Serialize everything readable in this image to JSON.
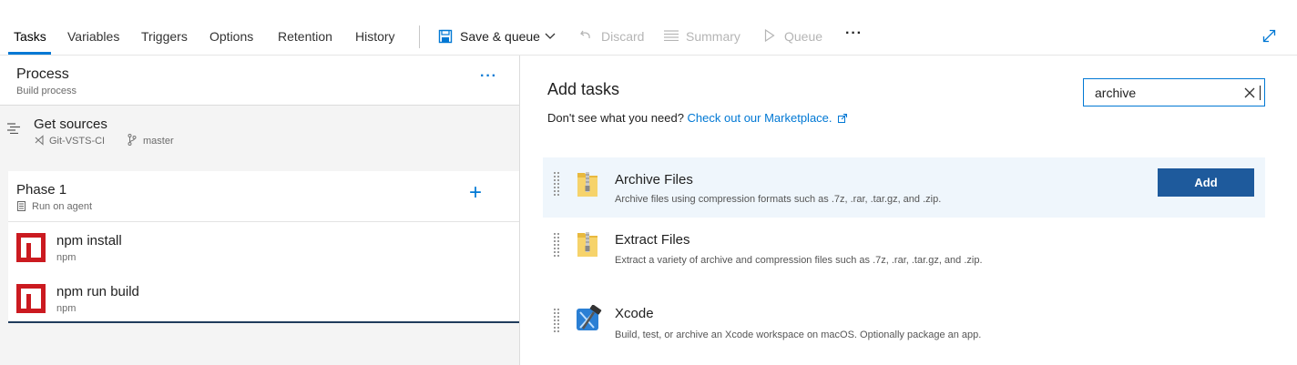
{
  "tabs": [
    {
      "label": "Tasks",
      "active": true
    },
    {
      "label": "Variables"
    },
    {
      "label": "Triggers"
    },
    {
      "label": "Options"
    },
    {
      "label": "Retention"
    },
    {
      "label": "History"
    }
  ],
  "toolbar": {
    "save_queue": "Save & queue",
    "discard": "Discard",
    "summary": "Summary",
    "queue": "Queue",
    "more": "···"
  },
  "process": {
    "title": "Process",
    "subtitle": "Build process",
    "more": "···"
  },
  "get_sources": {
    "title": "Get sources",
    "repo": "Git-VSTS-CI",
    "branch": "master"
  },
  "phase": {
    "title": "Phase 1",
    "subtitle": "Run on agent",
    "add": "+"
  },
  "phase_tasks": [
    {
      "title": "npm install",
      "subtitle": "npm"
    },
    {
      "title": "npm run build",
      "subtitle": "npm"
    }
  ],
  "add_tasks": {
    "title": "Add tasks",
    "dont_see": "Don't see what you need?",
    "marketplace": "Check out our Marketplace.",
    "search_value": "archive",
    "add_button": "Add"
  },
  "results": [
    {
      "title": "Archive Files",
      "desc": "Archive files using compression formats such as .7z, .rar, .tar.gz, and .zip.",
      "icon": "archive-folder-icon"
    },
    {
      "title": "Extract Files",
      "desc": "Extract a variety of archive and compression files such as .7z, .rar, .tar.gz, and .zip.",
      "icon": "archive-folder-icon"
    },
    {
      "title": "Xcode",
      "desc": "Build, test, or archive an Xcode workspace on macOS. Optionally package an app.",
      "icon": "xcode-icon"
    }
  ],
  "colors": {
    "accent": "#0078d4",
    "add_button": "#1e5a9c",
    "npm_red": "#cb1a20",
    "selected_row": "#eff6fc"
  }
}
